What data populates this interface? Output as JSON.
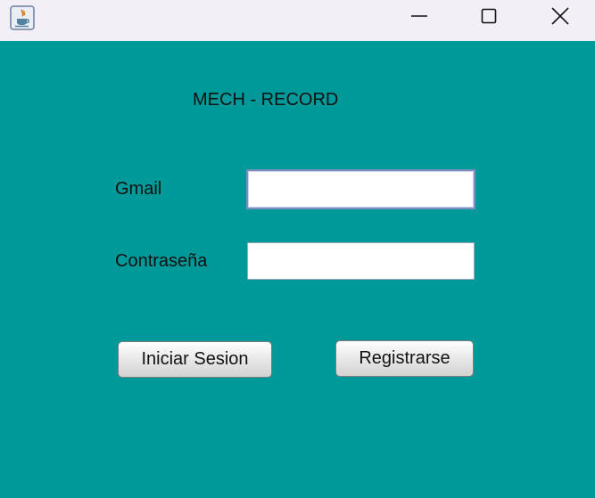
{
  "window": {
    "background_color": "#009999",
    "titlebar_color": "#f3eff6",
    "icons": {
      "app": "java-icon",
      "minimize": "minimize-icon",
      "maximize": "maximize-icon",
      "close": "close-icon"
    }
  },
  "form": {
    "title": "MECH - RECORD",
    "email_label": "Gmail",
    "email_value": "",
    "password_label": "Contraseña",
    "password_value": ""
  },
  "actions": {
    "login_label": "Iniciar Sesion",
    "register_label": "Registrarse"
  }
}
